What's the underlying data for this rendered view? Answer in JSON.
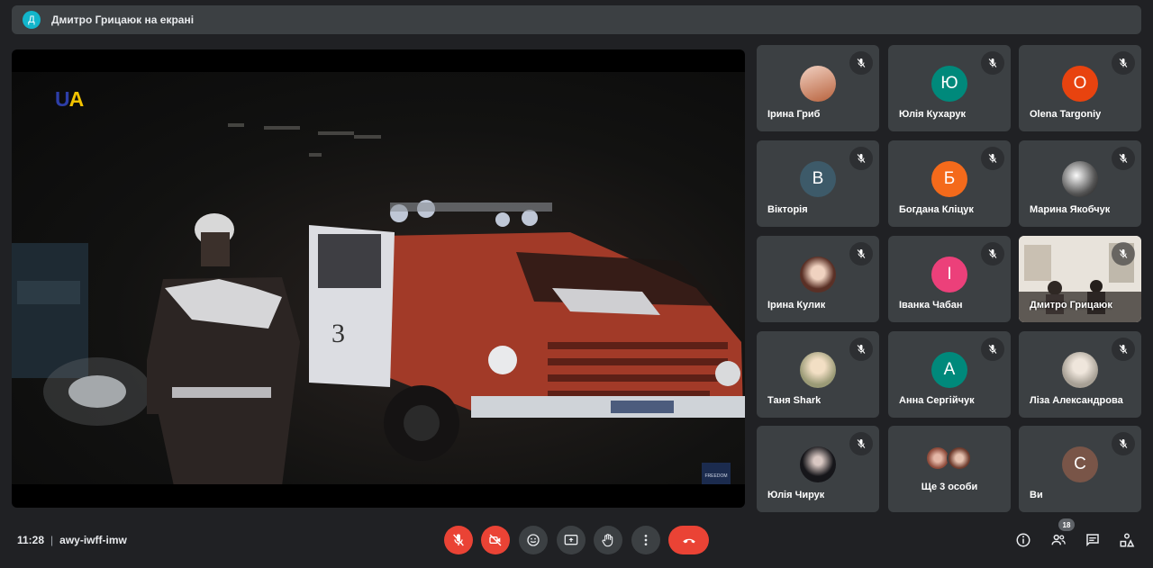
{
  "presenter_bar": {
    "avatar_letter": "Д",
    "text": "Дмитро Грицаюк на екрані"
  },
  "stage": {
    "logo": {
      "u": "U",
      "a": "A"
    },
    "badge": "FREEDOM",
    "truck_number": "3",
    "plate": "ДЖЗ"
  },
  "participants": [
    {
      "name": "Ірина Гриб",
      "avatar": "photo",
      "color": "#e9b9a4",
      "muted": true
    },
    {
      "name": "Юлія Кухарук",
      "avatar": "Ю",
      "color": "#00897b",
      "muted": true
    },
    {
      "name": "Olena Targoniy",
      "avatar": "O",
      "color": "#e8430f",
      "muted": true
    },
    {
      "name": "Вікторія",
      "avatar": "В",
      "color": "#3d5a69",
      "muted": true
    },
    {
      "name": "Богдана Кліцук",
      "avatar": "Б",
      "color": "#f46a1b",
      "muted": true
    },
    {
      "name": "Марина Якобчук",
      "avatar": "photo",
      "color": "#d9d9d9",
      "muted": true
    },
    {
      "name": "Ірина Кулик",
      "avatar": "photo",
      "color": "#6b3b2f",
      "muted": true
    },
    {
      "name": "Іванка Чабан",
      "avatar": "І",
      "color": "#ec407a",
      "muted": true
    },
    {
      "name": "Дмитро Грицаюк",
      "avatar": "video",
      "color": "#d9d2c8",
      "muted": true
    },
    {
      "name": "Таня Shark",
      "avatar": "photo",
      "color": "#c9c1a6",
      "muted": true
    },
    {
      "name": "Анна Сергійчук",
      "avatar": "А",
      "color": "#00897b",
      "muted": true
    },
    {
      "name": "Ліза Александрова",
      "avatar": "photo",
      "color": "#d6d0c5",
      "muted": true
    },
    {
      "name": "Юлія Чирук",
      "avatar": "photo",
      "color": "#16161a",
      "muted": true
    },
    {
      "name": "Ще 3 особи",
      "avatar": "group",
      "color": "#8d5a46",
      "muted": false
    },
    {
      "name": "Ви",
      "avatar": "С",
      "color": "#795548",
      "muted": true
    }
  ],
  "bottom_bar": {
    "time": "11:28",
    "separator": "|",
    "meeting_code": "awy-iwff-imw",
    "participant_count": "18"
  },
  "icons": {
    "mic_off": "mic-off-icon",
    "camera_off": "camera-off-icon",
    "emoji": "emoji-icon",
    "present": "present-screen-icon",
    "hand": "raise-hand-icon",
    "more": "more-options-icon",
    "hangup": "hang-up-icon",
    "info": "info-icon",
    "people": "people-icon",
    "chat": "chat-icon",
    "activities": "activities-icon"
  },
  "colors": {
    "background": "#202124",
    "tile": "#3c4043",
    "danger": "#ea4335"
  }
}
